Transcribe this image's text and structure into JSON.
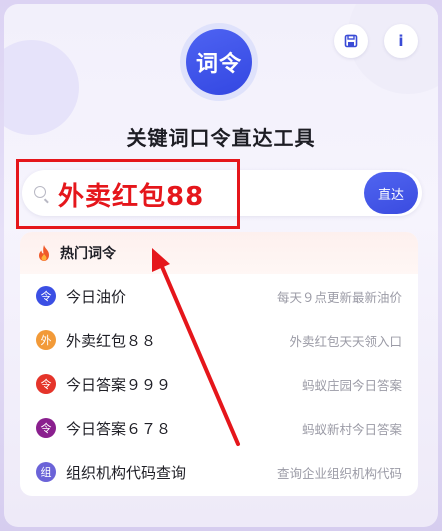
{
  "app": {
    "logo_text": "词令",
    "title": "关键词口令直达工具",
    "save_icon_glyph": "🖫",
    "info_icon_glyph": "i"
  },
  "search": {
    "value": "外卖红包88",
    "button_label": "直达"
  },
  "hot": {
    "header_label": "热门词令",
    "items": [
      {
        "title": "今日油价",
        "desc": "每天９点更新最新油价",
        "badge": "令",
        "color": "#3b4fe4"
      },
      {
        "title": "外卖红包８８",
        "desc": "外卖红包天天领入口",
        "badge": "外",
        "color": "#f29a38"
      },
      {
        "title": "今日答案９９９",
        "desc": "蚂蚁庄园今日答案",
        "badge": "令",
        "color": "#e5342a"
      },
      {
        "title": "今日答案６７８",
        "desc": "蚂蚁新村今日答案",
        "badge": "令",
        "color": "#8a1f8e"
      },
      {
        "title": "组织机构代码查询",
        "desc": "查询企业组织机构代码",
        "badge": "组",
        "color": "#6b63d8"
      }
    ]
  },
  "colors": {
    "accent": "#3a4be0",
    "highlight": "#e5161b",
    "hot_icon": "#f05a2a"
  }
}
